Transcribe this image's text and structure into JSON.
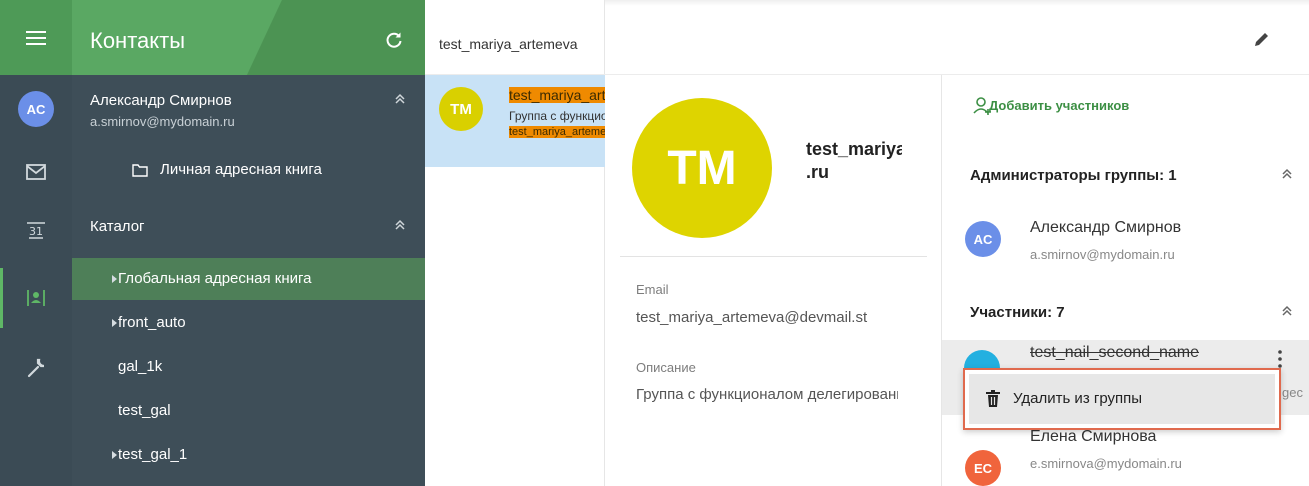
{
  "rail": {
    "avatar_initials": "AC",
    "icons": [
      "menu-icon",
      "mail-icon",
      "calendar-icon",
      "contacts-icon",
      "wrench-icon"
    ],
    "calendar_day": "31"
  },
  "sidebar": {
    "title": "Контакты",
    "user": {
      "name": "Александр Смирнов",
      "email": "a.smirnov@mydomain.ru"
    },
    "personal_book": "Личная адресная книга",
    "catalog_label": "Каталог",
    "items": [
      {
        "label": "Глобальная адресная книга",
        "has_caret": true,
        "active": true
      },
      {
        "label": "front_auto",
        "has_caret": true,
        "active": false
      },
      {
        "label": "gal_1k",
        "has_caret": false,
        "active": false
      },
      {
        "label": "test_gal",
        "has_caret": false,
        "active": false
      },
      {
        "label": "test_gal_1",
        "has_caret": true,
        "active": false
      }
    ]
  },
  "list": {
    "search_value": "test_mariya_artemeva",
    "item": {
      "initials": "TM",
      "name": "test_mariya_artemeva",
      "description": "Группа с функционалом делегирования",
      "email": "test_mariya_artemeva@devmail.st"
    }
  },
  "detail": {
    "initials": "TM",
    "name_line1": "test_mariya_artemeva@devmail",
    "name_line2": ".ru",
    "email_label": "Email",
    "email_value": "test_mariya_artemeva@devmail.st",
    "desc_label": "Описание",
    "desc_value": "Группа с функционалом делегирования"
  },
  "members": {
    "add_label": "Добавить участников",
    "admins_title": "Администраторы группы: 1",
    "admins": [
      {
        "initials": "AC",
        "name": "Александр Смирнов",
        "email": "a.smirnov@mydomain.ru",
        "color": "#6b8fe8"
      }
    ],
    "participants_title": "Участники: 7",
    "hovered": {
      "name": "test_nail_second_name",
      "tail": "gec"
    },
    "participants": [
      {
        "initials": "EC",
        "name": "Елена Смирнова",
        "email": "e.smirnova@mydomain.ru",
        "color": "#f0643c"
      }
    ],
    "context_menu": {
      "delete_label": "Удалить из группы"
    }
  },
  "colors": {
    "accent": "#4c9353",
    "sidebar": "#3e4e58",
    "highlight": "#ef8a00",
    "selection": "#c8e2f6"
  }
}
